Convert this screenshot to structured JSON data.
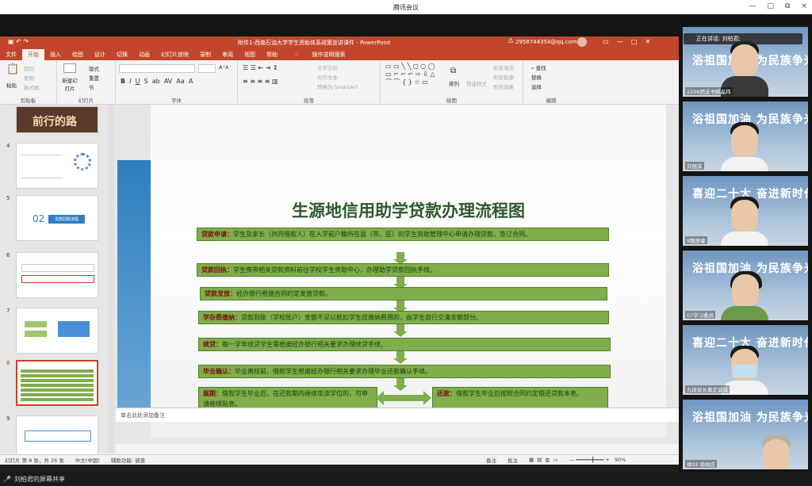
{
  "meeting": {
    "title": "腾讯会议",
    "controls": [
      "—",
      "□",
      "⧉",
      "×"
    ],
    "share_label": "刘柏君的屏幕共享"
  },
  "ppt": {
    "doc_title": "附件1-西南石油大学学生资助体系政策宣讲课件 - PowerPoint",
    "account": "2958744354@qq.com",
    "tabs": [
      "文件",
      "开始",
      "插入",
      "绘图",
      "设计",
      "切换",
      "动画",
      "幻灯片放映",
      "录制",
      "审阅",
      "视图",
      "帮助",
      "操作说明搜索"
    ],
    "ribbon": {
      "paste": "粘贴",
      "cut": "剪切",
      "copy": "复制",
      "format_painter": "格式刷",
      "new_slide": "新建幻灯片",
      "layout": "版式",
      "reset": "重置",
      "section": "节",
      "groups": {
        "clipboard": "剪贴板",
        "slides": "幻灯片",
        "font": "字体",
        "paragraph": "段落",
        "drawing": "绘图",
        "editing": "编辑"
      },
      "text_dir": "文字方向",
      "align_text": "对齐文本",
      "smartart": "转换为 SmartArt",
      "arrange": "排列",
      "quick_styles": "快速样式",
      "fill": "形状填充",
      "outline": "形状轮廓",
      "effects": "形状效果",
      "find": "查找",
      "replace": "替换",
      "select": "选择"
    },
    "thumb_numbers": [
      "4",
      "5",
      "6",
      "7",
      "8",
      "9"
    ],
    "thumb_texts": {
      "t3": "前行的路",
      "t5": "02",
      "t5b": "贷款回款流程"
    },
    "notes": "单击此处添加备注",
    "status": {
      "slide_info": "幻灯片 第 8 张，共 26 张",
      "lang": "中文(中国)",
      "access": "辅助功能: 调查",
      "notes": "备注",
      "comments": "批注",
      "zoom": "90%"
    }
  },
  "slide": {
    "title": "生源地信用助学贷款办理流程图",
    "steps": [
      {
        "label": "贷款申请：",
        "text": "学生及家长（共同借款人）在入学前户籍所在县（市、区）的学生资助管理中心申请办理贷款，签订合同。"
      },
      {
        "label": "贷款回执：",
        "text": "学生携带相关贷款资料前往学校学生资助中心，办理助学贷款回执手续。"
      },
      {
        "label": "贷款发放：",
        "text": "经办银行根据合同约定发放贷款。"
      },
      {
        "label": "学杂费缴纳：",
        "text": "贷款到账（学校账户）金额不足以抵扣学生应缴纳费用的，由学生自行交清余额部分。"
      },
      {
        "label": "续贷：",
        "text": "每一学年续贷学生需根据经办银行相关要求办理续贷手续。"
      },
      {
        "label": "毕业确认：",
        "text": "毕业离校前，借款学生根据经办银行相关要求办理毕业还款确认手续。"
      },
      {
        "label": "展期：",
        "text": "借款学生毕业后，在还款期内继续攻读学位的，可申请继续贴息。"
      },
      {
        "label": "还款：",
        "text": "借款学生毕业后按照合同约定偿还贷款本息。"
      }
    ]
  },
  "participants": {
    "speaking": "正在讲话: 刘柏君;",
    "videos": [
      {
        "name": "2206团支书郝晶玮",
        "caption": "浴祖国加油  为民族争光"
      },
      {
        "name": "刘丽泽",
        "caption": "浴祖国加油  为民族争光"
      },
      {
        "name": "9魏辰睿",
        "caption": "喜迎二十大  奋进新时代"
      },
      {
        "name": "07学习委员",
        "caption": "浴祖国加油  为民族争光"
      },
      {
        "name": "九班班长黄定诚诚",
        "caption": "喜迎二十大  奋进新时代"
      },
      {
        "name": "体02 段柏庄",
        "caption": "浴祖国加油  为民族争光"
      }
    ]
  }
}
